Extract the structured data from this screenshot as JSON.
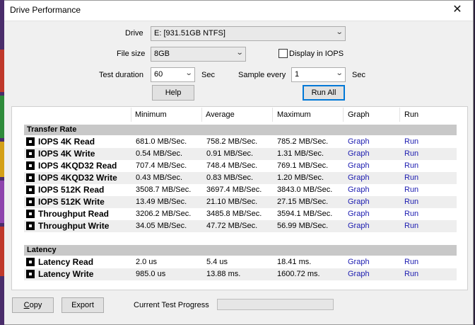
{
  "window": {
    "title": "Drive Performance"
  },
  "controls": {
    "drive_label": "Drive",
    "drive_value": "E: [931.51GB NTFS]",
    "file_size_label": "File size",
    "file_size_value": "8GB",
    "display_iops_label": "Display in IOPS",
    "display_iops_checked": false,
    "test_duration_label": "Test duration",
    "test_duration_value": "60",
    "test_duration_unit": "Sec",
    "sample_every_label": "Sample every",
    "sample_every_value": "1",
    "sample_every_unit": "Sec",
    "help_button": "Help",
    "run_all_button": "Run All"
  },
  "table": {
    "headers": [
      "Minimum",
      "Average",
      "Maximum",
      "Graph",
      "Run"
    ],
    "transfer_rate_title": "Transfer Rate",
    "transfer_rate_rows": [
      {
        "name": "IOPS 4K Read",
        "min": "681.0 MB/Sec.",
        "avg": "758.2 MB/Sec.",
        "max": "785.2 MB/Sec.",
        "graph": "Graph",
        "run": "Run"
      },
      {
        "name": "IOPS 4K Write",
        "min": "0.54 MB/Sec.",
        "avg": "0.91 MB/Sec.",
        "max": "1.31 MB/Sec.",
        "graph": "Graph",
        "run": "Run"
      },
      {
        "name": "IOPS 4KQD32 Read",
        "min": "707.4 MB/Sec.",
        "avg": "748.4 MB/Sec.",
        "max": "769.1 MB/Sec.",
        "graph": "Graph",
        "run": "Run"
      },
      {
        "name": "IOPS 4KQD32 Write",
        "min": "0.43 MB/Sec.",
        "avg": "0.83 MB/Sec.",
        "max": "1.20 MB/Sec.",
        "graph": "Graph",
        "run": "Run"
      },
      {
        "name": "IOPS 512K Read",
        "min": "3508.7 MB/Sec.",
        "avg": "3697.4 MB/Sec.",
        "max": "3843.0 MB/Sec.",
        "graph": "Graph",
        "run": "Run"
      },
      {
        "name": "IOPS 512K Write",
        "min": "13.49 MB/Sec.",
        "avg": "21.10 MB/Sec.",
        "max": "27.15 MB/Sec.",
        "graph": "Graph",
        "run": "Run"
      },
      {
        "name": "Throughput Read",
        "min": "3206.2 MB/Sec.",
        "avg": "3485.8 MB/Sec.",
        "max": "3594.1 MB/Sec.",
        "graph": "Graph",
        "run": "Run"
      },
      {
        "name": "Throughput Write",
        "min": "34.05 MB/Sec.",
        "avg": "47.72 MB/Sec.",
        "max": "56.99 MB/Sec.",
        "graph": "Graph",
        "run": "Run"
      }
    ],
    "latency_title": "Latency",
    "latency_rows": [
      {
        "name": "Latency Read",
        "min": "2.0 us",
        "avg": "5.4 us",
        "max": "18.41 ms.",
        "graph": "Graph",
        "run": "Run"
      },
      {
        "name": "Latency Write",
        "min": "985.0 us",
        "avg": "13.88 ms.",
        "max": "1600.72 ms.",
        "graph": "Graph",
        "run": "Run"
      }
    ]
  },
  "footer": {
    "copy_button": "Copy",
    "export_button": "Export",
    "progress_label": "Current Test Progress",
    "progress": 0
  }
}
